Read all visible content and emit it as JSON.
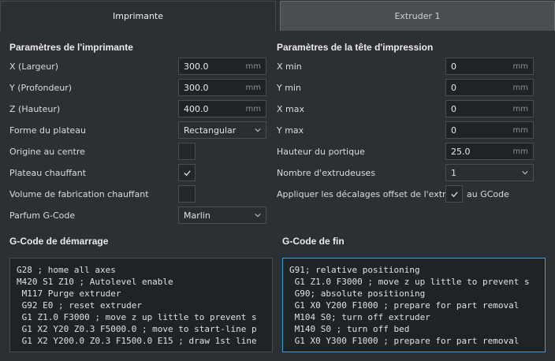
{
  "tabs": {
    "active": "Imprimante",
    "inactive": "Extruder 1"
  },
  "printer": {
    "title": "Paramètres de l'imprimante",
    "width_label": "X (Largeur)",
    "width_value": "300.0",
    "width_unit": "mm",
    "depth_label": "Y (Profondeur)",
    "depth_value": "300.0",
    "depth_unit": "mm",
    "height_label": "Z (Hauteur)",
    "height_value": "400.0",
    "height_unit": "mm",
    "bed_shape_label": "Forme du plateau",
    "bed_shape_value": "Rectangular",
    "origin_center_label": "Origine au centre",
    "origin_center_checked": false,
    "heated_bed_label": "Plateau chauffant",
    "heated_bed_checked": true,
    "heated_volume_label": "Volume de fabrication chauffant",
    "heated_volume_checked": false,
    "gcode_flavor_label": "Parfum G-Code",
    "gcode_flavor_value": "Marlin"
  },
  "printhead": {
    "title": "Paramètres de la tête d'impression",
    "xmin_label": "X min",
    "xmin_value": "0",
    "xmin_unit": "mm",
    "ymin_label": "Y min",
    "ymin_value": "0",
    "ymin_unit": "mm",
    "xmax_label": "X max",
    "xmax_value": "0",
    "xmax_unit": "mm",
    "ymax_label": "Y max",
    "ymax_value": "0",
    "ymax_unit": "mm",
    "gantry_label": "Hauteur du portique",
    "gantry_value": "25.0",
    "gantry_unit": "mm",
    "extruders_label": "Nombre d'extrudeuses",
    "extruders_value": "1",
    "offset_label_a": "Appliquer les décalages offset de l'extrud",
    "offset_label_b": "au GCode",
    "offset_checked": true
  },
  "start_gcode": {
    "title": "G-Code de démarrage",
    "lines": [
      "G28 ; home all axes",
      "M420 S1 Z10 ; Autolevel enable",
      " M117 Purge extruder",
      " G92 E0 ; reset extruder",
      " G1 Z1.0 F3000 ; move z up little to prevent s",
      " G1 X2 Y20 Z0.3 F5000.0 ; move to start-line p",
      " G1 X2 Y200.0 Z0.3 F1500.0 E15 ; draw 1st line"
    ]
  },
  "end_gcode": {
    "title": "G-Code de fin",
    "lines": [
      "G91; relative positioning",
      " G1 Z1.0 F3000 ; move z up little to prevent s",
      " G90; absolute positioning",
      " G1 X0 Y200 F1000 ; prepare for part removal",
      " M104 S0; turn off extruder",
      " M140 S0 ; turn off bed",
      " G1 X0 Y300 F1000 ; prepare for part removal"
    ]
  },
  "colors": {
    "background": "#2c2f33",
    "focus_border": "#3b9fd6",
    "field_bg": "#202326"
  }
}
